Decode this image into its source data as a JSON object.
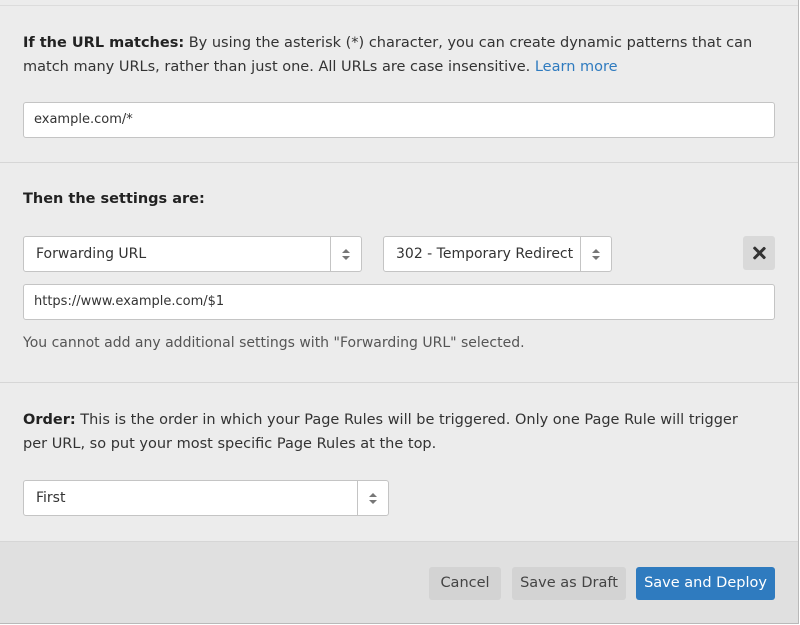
{
  "url_section": {
    "heading": "If the URL matches:",
    "description": " By using the asterisk (*) character, you can create dynamic patterns that can match many URLs, rather than just one. All URLs are case insensitive. ",
    "learn_more": "Learn more",
    "url_value": "example.com/*"
  },
  "settings_section": {
    "heading": "Then the settings are:",
    "setting_select": "Forwarding URL",
    "status_select": "302 - Temporary Redirect",
    "destination_value": "https://www.example.com/$1",
    "note": "You cannot add any additional settings with \"Forwarding URL\" selected."
  },
  "order_section": {
    "heading": "Order:",
    "description": " This is the order in which your Page Rules will be triggered. Only one Page Rule will trigger per URL, so put your most specific Page Rules at the top.",
    "order_select": "First"
  },
  "footer": {
    "cancel_label": "Cancel",
    "draft_label": "Save as Draft",
    "deploy_label": "Save and Deploy"
  },
  "colors": {
    "accent": "#2f7bbf",
    "background": "#ececec",
    "footer_background": "#e0e0e0"
  },
  "icons": {
    "remove": "close-icon",
    "select_arrows": "sort-arrows-icon"
  }
}
